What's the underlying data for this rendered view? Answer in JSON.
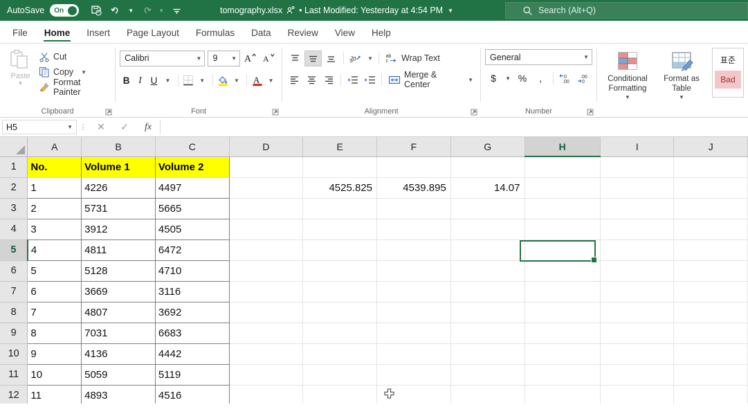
{
  "titlebar": {
    "autosave_label": "AutoSave",
    "autosave_state": "On",
    "document_name": "tomography.xlsx",
    "modified_status": "• Last Modified: Yesterday at 4:54 PM",
    "search_placeholder": "Search (Alt+Q)",
    "qat": [
      {
        "name": "save-icon",
        "label": "Save"
      },
      {
        "name": "undo-icon",
        "label": "Undo"
      },
      {
        "name": "redo-icon",
        "label": "Redo"
      },
      {
        "name": "customize-quick-access-toolbar-icon",
        "label": "Customize Quick Access Toolbar"
      }
    ],
    "accent_color": "#217346"
  },
  "ribbon": {
    "tabs": [
      {
        "label": "File",
        "active": false
      },
      {
        "label": "Home",
        "active": true
      },
      {
        "label": "Insert",
        "active": false
      },
      {
        "label": "Page Layout",
        "active": false
      },
      {
        "label": "Formulas",
        "active": false
      },
      {
        "label": "Data",
        "active": false
      },
      {
        "label": "Review",
        "active": false
      },
      {
        "label": "View",
        "active": false
      },
      {
        "label": "Help",
        "active": false
      }
    ],
    "clipboard": {
      "group_label": "Clipboard",
      "paste_label": "Paste",
      "cut_label": "Cut",
      "copy_label": "Copy",
      "format_painter_label": "Format Painter"
    },
    "font": {
      "group_label": "Font",
      "font_name": "Calibri",
      "font_size": "9",
      "bold_label": "B",
      "italic_label": "I",
      "underline_label": "U"
    },
    "alignment": {
      "group_label": "Alignment",
      "wrap_text_label": "Wrap Text",
      "merge_center_label": "Merge & Center"
    },
    "number": {
      "group_label": "Number",
      "format_value": "General",
      "currency_label": "$",
      "percent_label": "%",
      "comma_label": ","
    },
    "styles": {
      "conditional_formatting_label": "Conditional Formatting",
      "format_as_table_label": "Format as Table",
      "gallery": [
        {
          "label": "표준",
          "style": "normal"
        },
        {
          "label": "Bad",
          "style": "bad"
        }
      ]
    }
  },
  "formulabar": {
    "name_box_value": "H5",
    "cancel_label": "✕",
    "enter_label": "✓",
    "fx_label": "fx",
    "formula_value": ""
  },
  "grid": {
    "columns": [
      "A",
      "B",
      "C",
      "D",
      "E",
      "F",
      "G",
      "H",
      "I",
      "J"
    ],
    "selected_column": "H",
    "selected_row": "5",
    "selected_cell": "H5",
    "rows": [
      {
        "num": "1",
        "cells": [
          "No.",
          "Volume 1",
          "Volume 2",
          "",
          "",
          "",
          "",
          "",
          "",
          ""
        ]
      },
      {
        "num": "2",
        "cells": [
          "1",
          "4226",
          "4497",
          "",
          "4525.825",
          "4539.895",
          "14.07",
          "",
          "",
          ""
        ]
      },
      {
        "num": "3",
        "cells": [
          "2",
          "5731",
          "5665",
          "",
          "",
          "",
          "",
          "",
          "",
          ""
        ]
      },
      {
        "num": "4",
        "cells": [
          "3",
          "3912",
          "4505",
          "",
          "",
          "",
          "",
          "",
          "",
          ""
        ]
      },
      {
        "num": "5",
        "cells": [
          "4",
          "4811",
          "6472",
          "",
          "",
          "",
          "",
          "",
          "",
          ""
        ]
      },
      {
        "num": "6",
        "cells": [
          "5",
          "5128",
          "4710",
          "",
          "",
          "",
          "",
          "",
          "",
          ""
        ]
      },
      {
        "num": "7",
        "cells": [
          "6",
          "3669",
          "3116",
          "",
          "",
          "",
          "",
          "",
          "",
          ""
        ]
      },
      {
        "num": "8",
        "cells": [
          "7",
          "4807",
          "3692",
          "",
          "",
          "",
          "",
          "",
          "",
          ""
        ]
      },
      {
        "num": "9",
        "cells": [
          "8",
          "7031",
          "6683",
          "",
          "",
          "",
          "",
          "",
          "",
          ""
        ]
      },
      {
        "num": "10",
        "cells": [
          "9",
          "4136",
          "4442",
          "",
          "",
          "",
          "",
          "",
          "",
          ""
        ]
      },
      {
        "num": "11",
        "cells": [
          "10",
          "5059",
          "5119",
          "",
          "",
          "",
          "",
          "",
          "",
          ""
        ]
      },
      {
        "num": "12",
        "cells": [
          "11",
          "4893",
          "4516",
          "",
          "",
          "",
          "",
          "",
          "",
          ""
        ]
      }
    ],
    "header_fill_color": "#ffff00",
    "selection_color": "#217346"
  }
}
